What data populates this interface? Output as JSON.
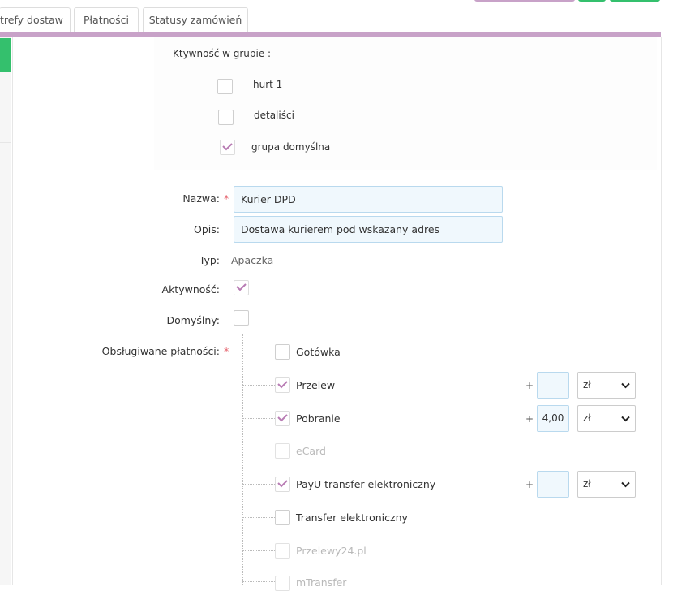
{
  "tabs": [
    {
      "label": "trefy dostaw"
    },
    {
      "label": "Płatności"
    },
    {
      "label": "Statusy zamówień"
    }
  ],
  "colors": {
    "accent": "#c8a2c8",
    "green": "#34c06d",
    "check": "#b77bb3",
    "input_bg": "#f0f8fd",
    "required": "#e5606b"
  },
  "groups": {
    "title": "Ktywność w grupie :",
    "items": [
      {
        "label": "hurt 1",
        "checked": false
      },
      {
        "label": "detaliści",
        "checked": false
      },
      {
        "label": "grupa domyślna",
        "checked": true
      }
    ]
  },
  "form": {
    "name_label": "Nazwa:",
    "name_value": "Kurier DPD",
    "desc_label": "Opis:",
    "desc_value": "Dostawa kurierem pod wskazany adres",
    "type_label": "Typ:",
    "type_value": "Apaczka",
    "active_label": "Aktywność:",
    "active_checked": true,
    "default_label": "Domyślny:",
    "default_checked": false,
    "payments_label": "Obsługiwane płatności:",
    "required_mark": "*"
  },
  "payments": [
    {
      "label": "Gotówka",
      "checked": false,
      "disabled": false
    },
    {
      "label": "Przelew",
      "checked": true,
      "disabled": false,
      "plus": "+",
      "amount": "",
      "currency": "zł"
    },
    {
      "label": "Pobranie",
      "checked": true,
      "disabled": false,
      "plus": "+",
      "amount": "4,00",
      "currency": "zł"
    },
    {
      "label": "eCard",
      "checked": false,
      "disabled": true
    },
    {
      "label": "PayU transfer elektroniczny",
      "checked": true,
      "disabled": false,
      "plus": "+",
      "amount": "",
      "currency": "zł"
    },
    {
      "label": "Transfer elektroniczny",
      "checked": false,
      "disabled": false
    },
    {
      "label": "Przelewy24.pl",
      "checked": false,
      "disabled": true
    },
    {
      "label": "mTransfer",
      "checked": false,
      "disabled": true
    }
  ]
}
